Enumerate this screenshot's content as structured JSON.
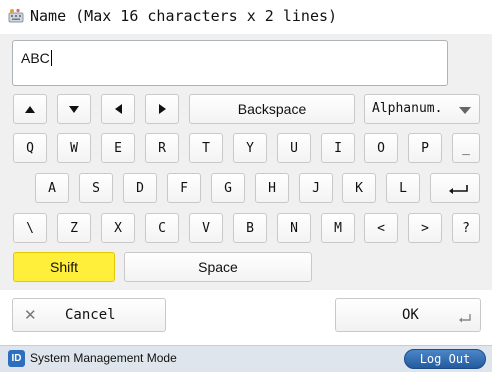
{
  "dialog": {
    "title": "Name (Max 16 characters x 2 lines)",
    "title_icon": "keyboard-input-icon"
  },
  "input": {
    "value": "ABC"
  },
  "keyboard": {
    "row_controls": {
      "backspace": "Backspace",
      "mode": "Alphanum."
    },
    "row1": [
      "Q",
      "W",
      "E",
      "R",
      "T",
      "Y",
      "U",
      "I",
      "O",
      "P",
      "_"
    ],
    "row2": [
      "A",
      "S",
      "D",
      "F",
      "G",
      "H",
      "J",
      "K",
      "L"
    ],
    "row3": [
      "\\",
      "Z",
      "X",
      "C",
      "V",
      "B",
      "N",
      "M",
      "<",
      ">",
      "?"
    ],
    "shift": "Shift",
    "space": "Space",
    "enter_icon": "enter-icon"
  },
  "actions": {
    "cancel": "Cancel",
    "ok": "OK"
  },
  "status": {
    "mode": "System Management Mode",
    "badge": "ID",
    "logout": "Log Out"
  },
  "colors": {
    "shift_active": "#ffef3a",
    "logout_button": "#2d6fbf",
    "status_bar": "#dfe5ec"
  }
}
